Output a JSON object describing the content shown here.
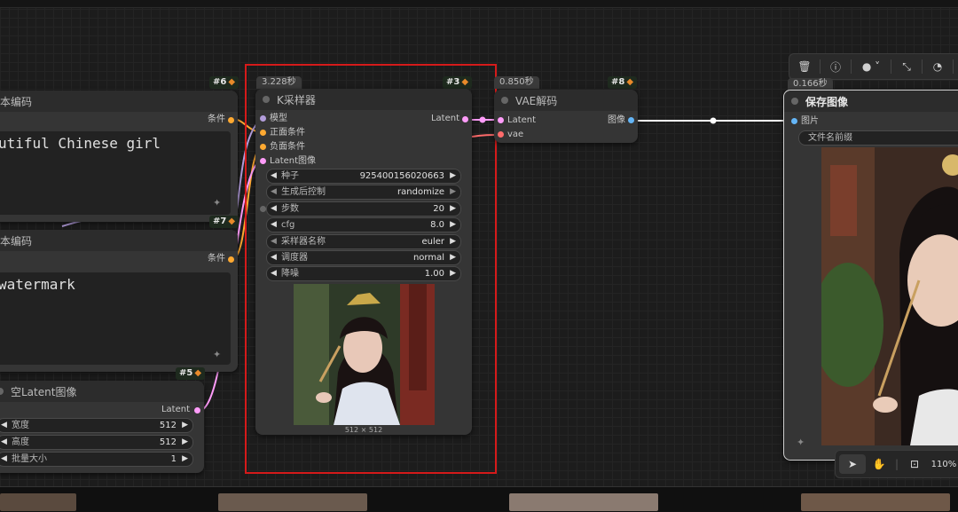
{
  "nodes": {
    "text_encode_pos": {
      "title": "本编码",
      "badge": "#6",
      "output": "条件",
      "text": "utiful Chinese girl"
    },
    "text_encode_neg": {
      "title": "本编码",
      "badge": "#7",
      "output": "条件",
      "text": " watermark"
    },
    "empty_latent": {
      "title": "空Latent图像",
      "badge": "#5",
      "output": "Latent",
      "widgets": [
        {
          "label": "宽度",
          "value": "512"
        },
        {
          "label": "高度",
          "value": "512"
        },
        {
          "label": "批量大小",
          "value": "1"
        }
      ]
    },
    "ksampler": {
      "time": "3.228秒",
      "title": "K采样器",
      "badge": "#3",
      "inputs": [
        "模型",
        "正面条件",
        "负面条件",
        "Latent图像"
      ],
      "output": "Latent",
      "widgets": [
        {
          "label": "种子",
          "value": "925400156020663"
        },
        {
          "label": "生成后控制",
          "value": "randomize"
        },
        {
          "label": "步数",
          "value": "20"
        },
        {
          "label": "cfg",
          "value": "8.0"
        },
        {
          "label": "采样器名称",
          "value": "euler"
        },
        {
          "label": "调度器",
          "value": "normal"
        },
        {
          "label": "降噪",
          "value": "1.00"
        }
      ],
      "preview_size": "512 × 512"
    },
    "vae_decode": {
      "time": "0.850秒",
      "title": "VAE解码",
      "badge": "#8",
      "inputs": [
        "Latent",
        "vae"
      ],
      "output": "图像"
    },
    "save_image": {
      "time": "0.166秒",
      "title": "保存图像",
      "input": "图片",
      "filename_prefix": "文件名前缀"
    }
  },
  "zoom": "110%",
  "colors": {
    "accent_highlight": "#d51a1a",
    "wire_latent": "#ff9cf9",
    "wire_cond": "#ffa931",
    "wire_image": "#64b5f6",
    "node_bg": "#353535"
  },
  "icons": {
    "fox": "fox-badge-icon",
    "sparkle": "sparkle-icon"
  }
}
